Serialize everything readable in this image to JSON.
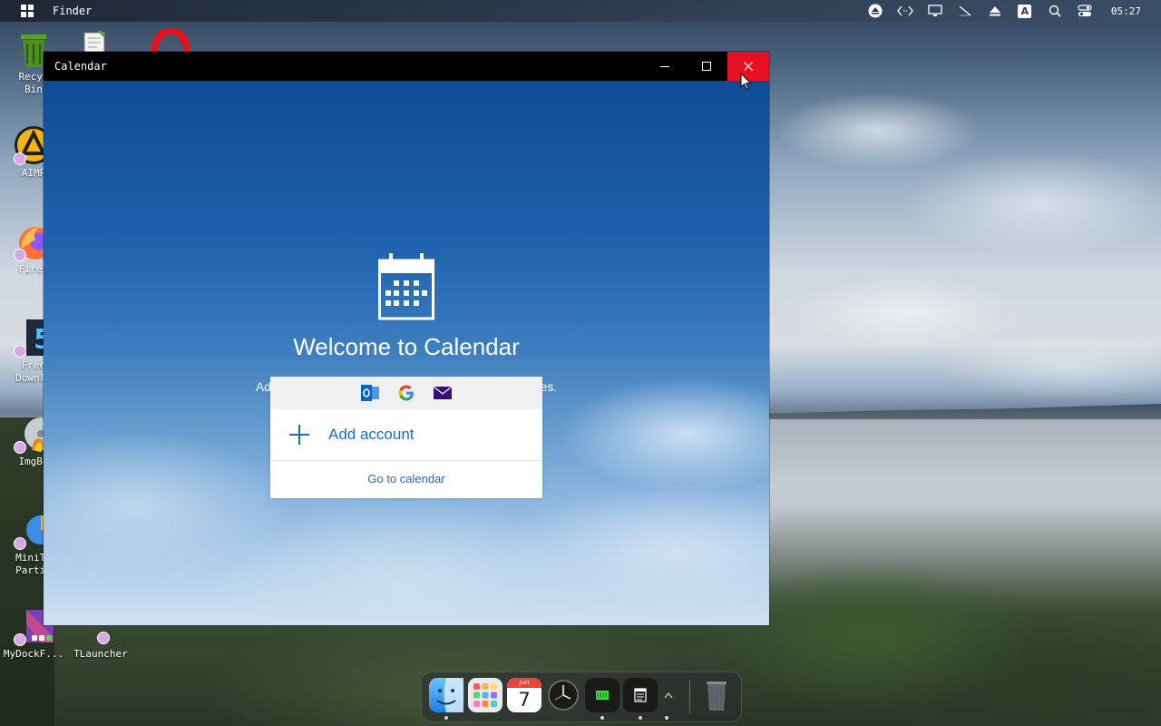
{
  "menubar": {
    "app_name": "Finder",
    "clock": "05:27",
    "tray_icons": [
      "eject-icon",
      "code-arrows-icon",
      "monitor-icon",
      "network-off-icon",
      "eject-small-icon",
      "keyboard-a-icon",
      "search-icon",
      "control-center-icon"
    ],
    "keyboard_letter": "A"
  },
  "desktop": {
    "icons": [
      {
        "label": "Recyc\nBin"
      },
      {
        "label": "AIMP"
      },
      {
        "label": "Firef"
      },
      {
        "label": "Free\nDownl."
      },
      {
        "label": "ImgBu"
      },
      {
        "label": "MiniTo\nPartit"
      },
      {
        "label": "MyDockF..."
      },
      {
        "label": "TLauncher"
      }
    ]
  },
  "window": {
    "title": "Calendar",
    "minimize_symbol": "—",
    "maximize_symbol": "☐",
    "close_symbol": "✕",
    "welcome_title": "Welcome to Calendar",
    "welcome_subtitle": "Add your accounts to keep up to date across devices.",
    "providers": [
      "outlook-icon",
      "google-icon",
      "mail-icon"
    ],
    "add_account_label": "Add account",
    "go_to_calendar_label": "Go to calendar"
  },
  "dock": {
    "calendar_month": "Jun",
    "calendar_day": "7",
    "items": [
      "finder-icon",
      "launchpad-icon",
      "calendar-icon",
      "clock-icon",
      "terminal-icon",
      "calendar-window-icon",
      "arrow-icon",
      "trash-icon"
    ],
    "colors": {
      "finder": "#3a8ee6",
      "close_red": "#e81123",
      "accent_blue": "#1a6fc4"
    }
  }
}
